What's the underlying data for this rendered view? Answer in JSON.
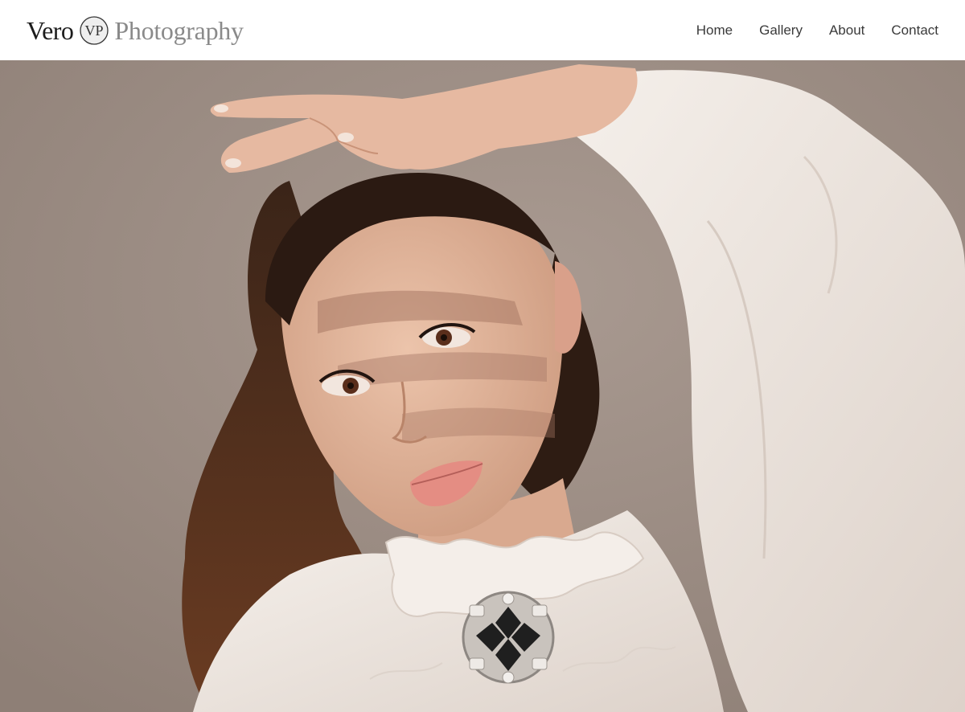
{
  "header": {
    "logo": {
      "first_word": "Vero",
      "monogram": "VP",
      "second_word": "Photography"
    },
    "nav": [
      {
        "label": "Home"
      },
      {
        "label": "Gallery"
      },
      {
        "label": "About"
      },
      {
        "label": "Contact"
      }
    ]
  },
  "hero": {
    "description": "Studio portrait photograph of a woman in a white ruffled blouse with a jeweled brooch, her hand raised above her head casting shadows across her face",
    "colors": {
      "backdrop": "#9c8c83",
      "skin": "#e2b49b",
      "hair": "#2b1a12",
      "blouse": "#efe7e1"
    }
  }
}
